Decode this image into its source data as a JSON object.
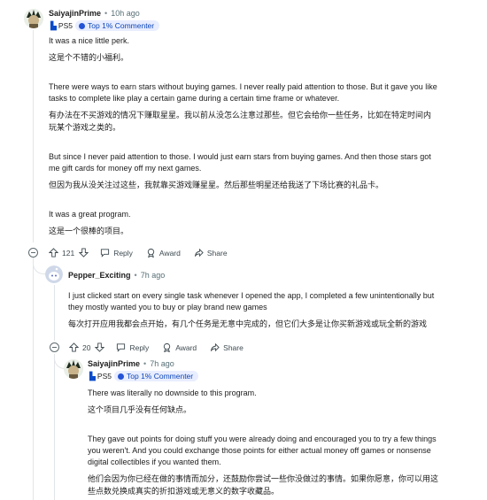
{
  "comments": [
    {
      "author": "SaiyajinPrime",
      "separator": "•",
      "time": "10h ago",
      "flair_ps": "PS5",
      "flair_top": "Top 1% Commenter",
      "lines": [
        "It was a nice little perk.",
        "这是个不错的小福利。",
        "There were ways to earn stars without buying games. I never really paid attention to those. But it gave you like",
        "tasks to complete like play a certain game during a certain time frame or whatever.",
        "有办法在不买游戏的情况下赚取星星。我以前从没怎么注意过那些。但它会给你一些任务，比如在特定时间内",
        "玩某个游戏之类的。",
        "But since I never paid attention to those. I would just earn stars from buying games. And then those stars got",
        "me gift cards for money off my next games.",
        "但因为我从没关注过这些，我就靠买游戏赚星星。然后那些明星还给我送了下场比赛的礼品卡。",
        "It was a great program.",
        "这是一个很棒的项目。"
      ],
      "votes": "121",
      "reply": "Reply",
      "award": "Award",
      "share": "Share"
    },
    {
      "author": "Pepper_Exciting",
      "separator": "•",
      "time": "7h ago",
      "lines": [
        "I just clicked start on every single task whenever I opened the app, I completed a few unintentionally but",
        "they mostly wanted you to buy or play brand new games",
        "每次打开应用我都会点开始，有几个任务是无意中完成的，但它们大多是让你买新游戏或玩全新的游戏"
      ],
      "votes": "20",
      "reply": "Reply",
      "award": "Award",
      "share": "Share"
    },
    {
      "author": "SaiyajinPrime",
      "separator": "•",
      "time": "7h ago",
      "flair_ps": "PS5",
      "flair_top": "Top 1% Commenter",
      "lines": [
        "There was literally no downside to this program.",
        "这个项目几乎没有任何缺点。",
        "They gave out points for doing stuff you were already doing and encouraged you to try a few things",
        "you weren't. And you could exchange those points for either actual money off games or nonsense",
        "digital collectibles if you wanted them.",
        "他们会因为你已经在做的事情而加分，还鼓励你尝试一些你没做过的事情。如果你愿意，你可以用这",
        "些点数兑换成真实的折扣游戏或无意义的数字收藏品。"
      ]
    }
  ],
  "colors": {
    "accent": "#0a4cc9",
    "flair_bg": "#e8edff",
    "flair_text": "#0b45b8",
    "meta": "#576f76",
    "thread": "#e2e5e7"
  },
  "icons": [
    "avatar-saiyan",
    "avatar-snoo",
    "upvote-icon",
    "downvote-icon",
    "reply-icon",
    "award-icon",
    "share-icon",
    "collapse-icon",
    "playstation-icon",
    "trophy-icon"
  ]
}
